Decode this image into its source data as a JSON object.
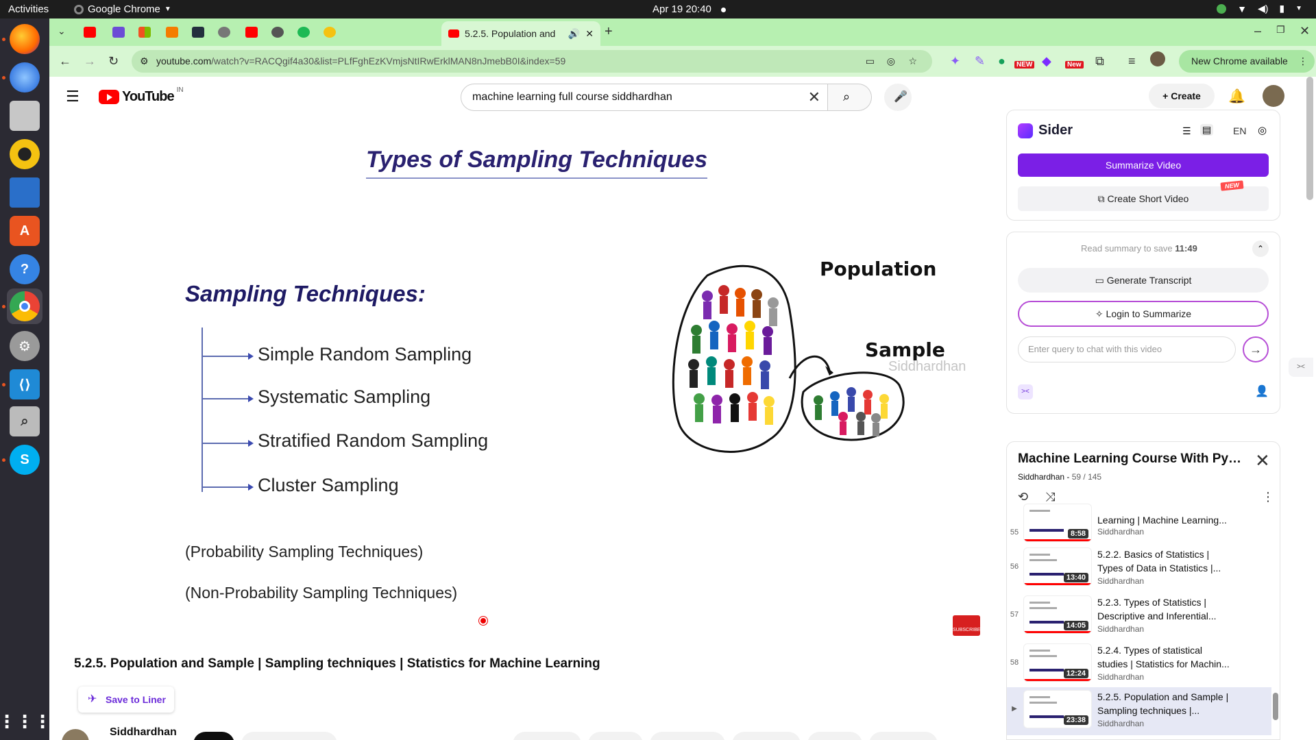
{
  "system": {
    "activities": "Activities",
    "app_name": "Google Chrome",
    "clock": "Apr 19  20:40"
  },
  "browser": {
    "active_tab_title": "5.2.5. Population and",
    "url_host": "youtube.com",
    "url_path": "/watch?v=RACQgif4a30&list=PLfFghEzKVmjsNtIRwErklMAN8nJmebB0I&index=59",
    "new_chrome_label": "New Chrome available",
    "ext_new_badge": "NEW",
    "ext_new_badge2": "New"
  },
  "youtube": {
    "logo_text": "YouTube",
    "country_code": "IN",
    "search_query": "machine learning full course siddhardhan",
    "create_label": "Create"
  },
  "video": {
    "slide_title": "Types of Sampling Techniques",
    "slide_subtitle": "Sampling Techniques:",
    "techniques": [
      "Simple Random Sampling",
      "Systematic Sampling",
      "Stratified Random Sampling",
      "Cluster Sampling"
    ],
    "note_probability": "(Probability Sampling Techniques)",
    "note_non_probability": "(Non-Probability Sampling Techniques)",
    "population_label": "Population",
    "sample_label": "Sample",
    "watermark": "Siddhardhan",
    "subscribe_label": "SUBSCRIBE"
  },
  "video_info": {
    "title": "5.2.5. Population and Sample | Sampling techniques | Statistics for Machine Learning",
    "save_to_liner": "Save to Liner",
    "channel": "Siddhardhan"
  },
  "sider": {
    "brand": "Sider",
    "language": "EN",
    "summarize_video": "Summarize Video",
    "create_short_video": "Create Short Video",
    "new_badge": "NEW",
    "read_summary_prefix": "Read summary to save",
    "read_summary_time": "11:49",
    "generate_transcript": "Generate Transcript",
    "login_to_summarize": "Login to Summarize",
    "chat_placeholder": "Enter query to chat with this video"
  },
  "playlist": {
    "title": "Machine Learning Course With Pyth...",
    "channel": "Siddhardhan",
    "position": "59 / 145",
    "items": [
      {
        "index": "55",
        "title": "Learning | Machine Learning...",
        "channel": "Siddhardhan",
        "duration": "8:58"
      },
      {
        "index": "56",
        "title": "5.2.2. Basics of Statistics | Types of Data in Statistics |...",
        "channel": "Siddhardhan",
        "duration": "13:40"
      },
      {
        "index": "57",
        "title": "5.2.3. Types of Statistics | Descriptive and Inferential...",
        "channel": "Siddhardhan",
        "duration": "14:05"
      },
      {
        "index": "58",
        "title": "5.2.4. Types of statistical studies | Statistics for Machin...",
        "channel": "Siddhardhan",
        "duration": "12:24"
      },
      {
        "index": "▶",
        "title": "5.2.5. Population and Sample | Sampling techniques |...",
        "channel": "Siddhardhan",
        "duration": "23:38"
      }
    ]
  },
  "colors": {
    "chrome_tabstrip": "#b7f0b1",
    "chrome_toolbar": "#d8f7d3",
    "sider_purple": "#7b1fe6",
    "slide_title_color": "#2a2170"
  }
}
